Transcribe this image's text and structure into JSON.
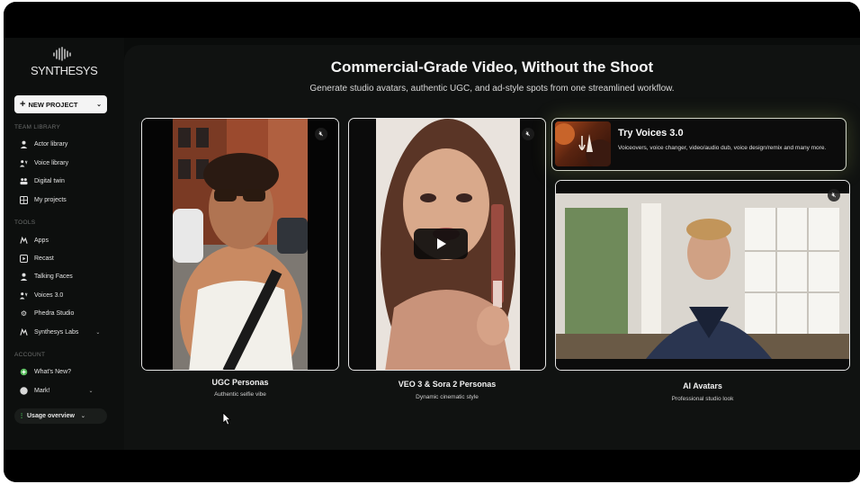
{
  "brand": {
    "name": "SYNTHESYS"
  },
  "sidebar": {
    "new_project_label": "NEW PROJECT",
    "team_library_title": "TEAM LIBRARY",
    "team_items": [
      {
        "label": "Actor library",
        "icon": "person-icon"
      },
      {
        "label": "Voice library",
        "icon": "voice-people-icon"
      },
      {
        "label": "Digital twin",
        "icon": "twin-icon"
      },
      {
        "label": "My projects",
        "icon": "grid-icon"
      }
    ],
    "tools_title": "TOOLS",
    "tool_items": [
      {
        "label": "Apps",
        "icon": "apps-icon"
      },
      {
        "label": "Recast",
        "icon": "recast-icon"
      },
      {
        "label": "Talking Faces",
        "icon": "person-icon"
      },
      {
        "label": "Voices 3.0",
        "icon": "voice-people-icon"
      },
      {
        "label": "Phedra Studio",
        "icon": "gear-icon"
      },
      {
        "label": "Synthesys Labs",
        "icon": "labs-icon"
      }
    ],
    "account_title": "ACCOUNT",
    "account_items": [
      {
        "label": "What's New?",
        "icon": "sparkle-icon"
      },
      {
        "label": "Mark!",
        "icon": "avatar-icon"
      }
    ],
    "usage_label": "Usage overview"
  },
  "main": {
    "headline": "Commercial-Grade Video, Without the Shoot",
    "subline": "Generate studio avatars, authentic UGC, and ad-style spots from one streamlined workflow.",
    "cards": [
      {
        "title": "UGC Personas",
        "subtitle": "Authentic selfie vibe"
      },
      {
        "title": "VEO 3 & Sora 2 Personas",
        "subtitle": "Dynamic cinematic style"
      },
      {
        "title": "AI Avatars",
        "subtitle": "Professional studio look"
      }
    ],
    "voices_promo": {
      "title": "Try Voices 3.0",
      "description": "Voiceovers, voice changer, video/audio dub, voice design/remix and many more."
    }
  },
  "colors": {
    "accent_green": "#4ad15a",
    "background": "#0a0c0b"
  }
}
